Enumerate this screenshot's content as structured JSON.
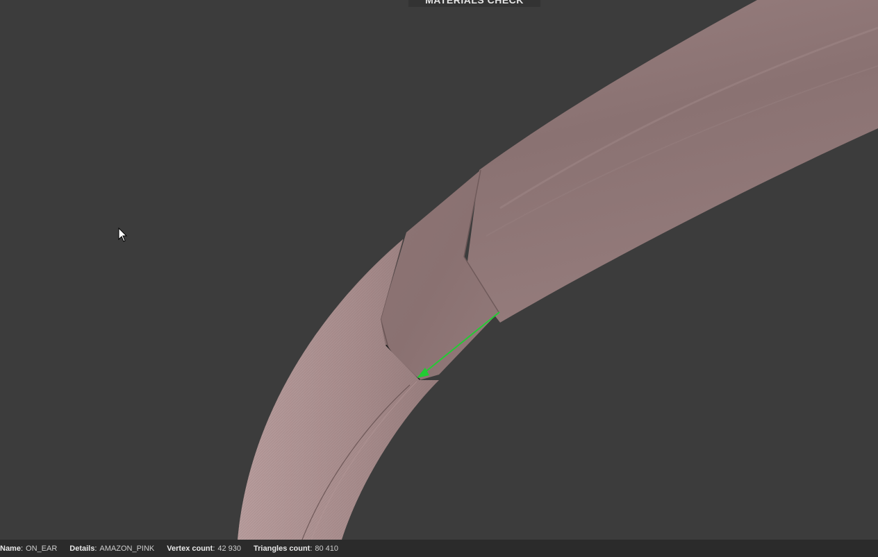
{
  "header": {
    "mode_title": "MATERIALS CHECK"
  },
  "viewport": {
    "background_color": "#3c3c3c",
    "model_color": "#8e7676",
    "annotation_arrow_color": "#22cc33",
    "cursor_icon": "arrow-cursor-icon"
  },
  "status_bar": {
    "name_label": "Name",
    "name_value": "ON_EAR",
    "details_label": "Details",
    "details_value": "AMAZON_PINK",
    "vertex_label": "Vertex count",
    "vertex_value": "42 930",
    "triangles_label": "Triangles count",
    "triangles_value": "80 410"
  }
}
